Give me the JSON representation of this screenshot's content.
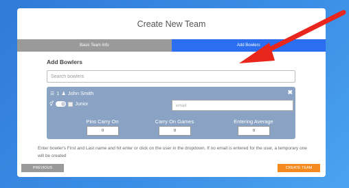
{
  "modal": {
    "title": "Create New Team",
    "tabs": [
      {
        "label": "Basic Team Info",
        "active": false
      },
      {
        "label": "Add Bowlers",
        "active": true
      }
    ],
    "section_title": "Add Bowlers",
    "search": {
      "placeholder": "Search bowlers",
      "value": ""
    },
    "bowler": {
      "number": "1",
      "name": "John Smith",
      "junior_label": "Junior",
      "email_placeholder": "email",
      "fields": [
        {
          "label": "Pins Carry On",
          "value": "0"
        },
        {
          "label": "Carry On Games",
          "value": "0"
        },
        {
          "label": "Entering Average",
          "value": "0"
        }
      ]
    },
    "help_text": "Enter bowler's First and Last name and hit enter or click on the user in the dropdown. If no email is entered for the user, a temporary one will be created",
    "buttons": {
      "previous": "PREVIOUS",
      "create": "CREATE TEAM"
    }
  },
  "colors": {
    "active_tab": "#2b6ff0",
    "card": "#8aa3c4",
    "create_button": "#f58a1f",
    "arrow": "#e8261c"
  },
  "icons": [
    "reorder-icon",
    "user-icon",
    "close-icon",
    "gender-icon"
  ]
}
